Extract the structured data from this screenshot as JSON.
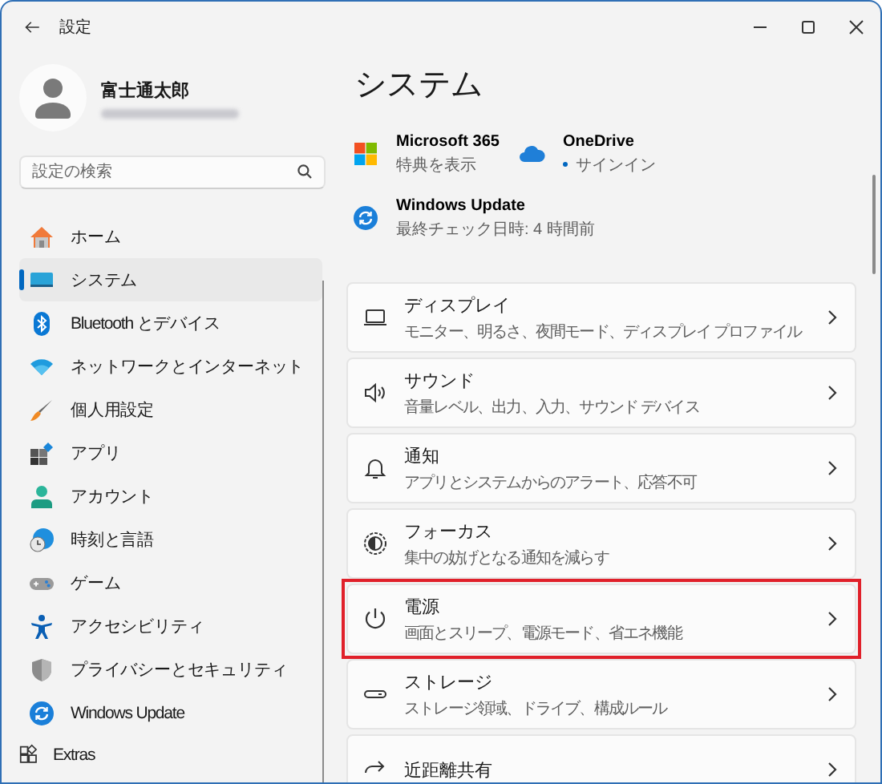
{
  "window": {
    "title": "設定"
  },
  "profile": {
    "name": "富士通太郎",
    "email_blurred": true
  },
  "search": {
    "placeholder": "設定の検索"
  },
  "sidebar": {
    "items": [
      {
        "label": "ホーム",
        "selected": false,
        "kind": "page"
      },
      {
        "label": "システム",
        "selected": true,
        "kind": "page"
      },
      {
        "label": "Bluetooth とデバイス",
        "selected": false,
        "kind": "page"
      },
      {
        "label": "ネットワークとインターネット",
        "selected": false,
        "kind": "page"
      },
      {
        "label": "個人用設定",
        "selected": false,
        "kind": "page"
      },
      {
        "label": "アプリ",
        "selected": false,
        "kind": "page"
      },
      {
        "label": "アカウント",
        "selected": false,
        "kind": "page"
      },
      {
        "label": "時刻と言語",
        "selected": false,
        "kind": "page"
      },
      {
        "label": "ゲーム",
        "selected": false,
        "kind": "page"
      },
      {
        "label": "アクセシビリティ",
        "selected": false,
        "kind": "page"
      },
      {
        "label": "プライバシーとセキュリティ",
        "selected": false,
        "kind": "page"
      },
      {
        "label": "Windows Update",
        "selected": false,
        "kind": "page"
      },
      {
        "label": "Extras",
        "selected": false,
        "kind": "extension"
      }
    ]
  },
  "main": {
    "heading": "システム",
    "tiles": [
      {
        "title": "Microsoft 365",
        "subtitle": "特典を表示",
        "dot": false
      },
      {
        "title": "OneDrive",
        "subtitle": "サインイン",
        "dot": true
      },
      {
        "title": "Windows Update",
        "subtitle": "最終チェック日時: 4 時間前",
        "dot": false
      }
    ],
    "cards": [
      {
        "title": "ディスプレイ",
        "subtitle": "モニター、明るさ、夜間モード、ディスプレイ プロファイル",
        "highlighted": false
      },
      {
        "title": "サウンド",
        "subtitle": "音量レベル、出力、入力、サウンド デバイス",
        "highlighted": false
      },
      {
        "title": "通知",
        "subtitle": "アプリとシステムからのアラート、応答不可",
        "highlighted": false
      },
      {
        "title": "フォーカス",
        "subtitle": "集中の妨げとなる通知を減らす",
        "highlighted": false
      },
      {
        "title": "電源",
        "subtitle": "画面とスリープ、電源モード、省エネ機能",
        "highlighted": true
      },
      {
        "title": "ストレージ",
        "subtitle": "ストレージ領域、ドライブ、構成ルール",
        "highlighted": false
      },
      {
        "title": "近距離共有",
        "highlighted": false
      }
    ]
  }
}
